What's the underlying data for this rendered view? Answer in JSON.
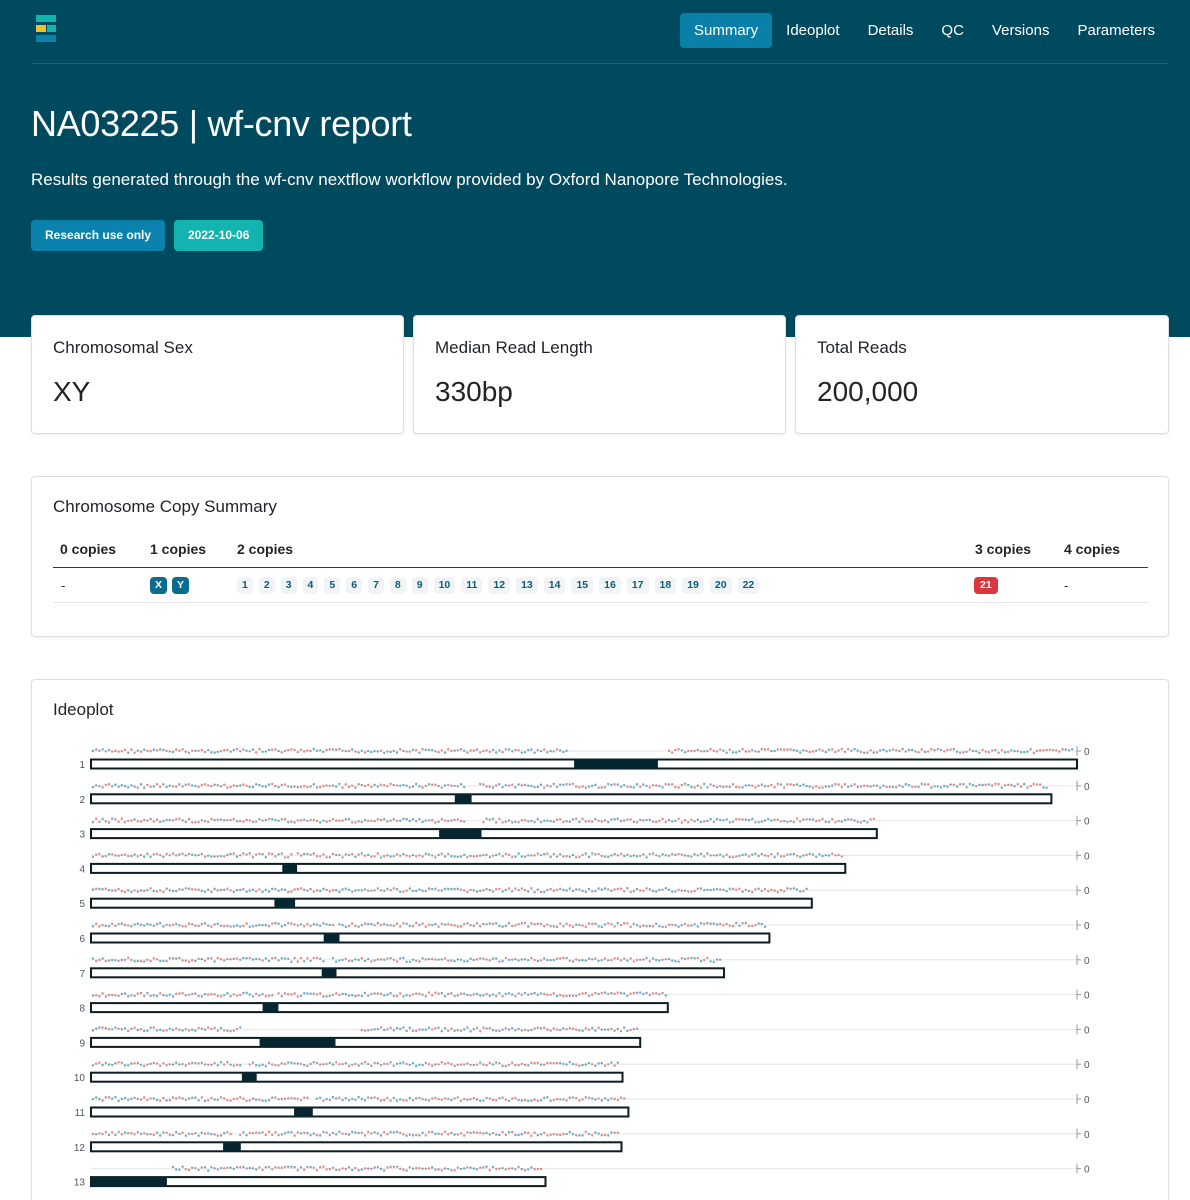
{
  "brand": {
    "logo_icon": "epi2me-logo-icon",
    "colors": {
      "teal": "#13b3b0",
      "yellow": "#f2c12e",
      "blue": "#0b82ad"
    }
  },
  "nav": {
    "items": [
      {
        "label": "Summary",
        "active": true
      },
      {
        "label": "Ideoplot",
        "active": false
      },
      {
        "label": "Details",
        "active": false
      },
      {
        "label": "QC",
        "active": false
      },
      {
        "label": "Versions",
        "active": false
      },
      {
        "label": "Parameters",
        "active": false
      }
    ]
  },
  "header": {
    "title": "NA03225 | wf-cnv report",
    "subtitle": "Results generated through the wf-cnv nextflow workflow provided by Oxford Nanopore Technologies.",
    "badges": {
      "ruo": "Research use only",
      "date": "2022-10-06"
    }
  },
  "stats": [
    {
      "label": "Chromosomal Sex",
      "value": "XY"
    },
    {
      "label": "Median Read Length",
      "value": "330bp"
    },
    {
      "label": "Total Reads",
      "value": "200,000"
    }
  ],
  "copy_summary": {
    "title": "Chromosome Copy Summary",
    "columns": [
      "0 copies",
      "1 copies",
      "2 copies",
      "3 copies",
      "4 copies"
    ],
    "zero_copies": "-",
    "one_copies": [
      "X",
      "Y"
    ],
    "two_copies": [
      "1",
      "2",
      "3",
      "4",
      "5",
      "6",
      "7",
      "8",
      "9",
      "10",
      "11",
      "12",
      "13",
      "14",
      "15",
      "16",
      "17",
      "18",
      "19",
      "20",
      "22"
    ],
    "three_copies": [
      "21"
    ],
    "four_copies": "-"
  },
  "ideoplot": {
    "title": "Ideoplot",
    "axis_tick": "0",
    "chromosomes": [
      {
        "label": "1",
        "length": 1.0,
        "centromere": [
          0.49,
          0.575
        ],
        "gap": [
          0.483,
          0.585
        ]
      },
      {
        "label": "2",
        "length": 0.974,
        "centromere": [
          0.369,
          0.386
        ],
        "gap": [
          0.38,
          0.392
        ]
      },
      {
        "label": "3",
        "length": 0.797,
        "centromere": [
          0.353,
          0.396
        ],
        "gap": [
          0.381,
          0.397
        ]
      },
      {
        "label": "4",
        "length": 0.765,
        "centromere": [
          0.194,
          0.209
        ],
        "gap": [
          0.205,
          0.208
        ]
      },
      {
        "label": "5",
        "length": 0.731,
        "centromere": [
          0.186,
          0.207
        ],
        "gap": null
      },
      {
        "label": "6",
        "length": 0.688,
        "centromere": [
          0.236,
          0.252
        ],
        "gap": [
          0.246,
          0.249
        ]
      },
      {
        "label": "7",
        "length": 0.642,
        "centromere": [
          0.234,
          0.249
        ],
        "gap": [
          0.237,
          0.244
        ]
      },
      {
        "label": "8",
        "length": 0.585,
        "centromere": [
          0.174,
          0.19
        ],
        "gap": [
          0.186,
          0.188
        ]
      },
      {
        "label": "9",
        "length": 0.557,
        "centromere": [
          0.171,
          0.248
        ],
        "gap": [
          0.152,
          0.274
        ]
      },
      {
        "label": "10",
        "length": 0.539,
        "centromere": [
          0.153,
          0.168
        ],
        "gap": [
          0.153,
          0.16
        ]
      },
      {
        "label": "11",
        "length": 0.545,
        "centromere": [
          0.206,
          0.225
        ],
        "gap": [
          0.221,
          0.226
        ]
      },
      {
        "label": "12",
        "length": 0.538,
        "centromere": [
          0.134,
          0.152
        ],
        "gap": [
          0.142,
          0.149
        ]
      },
      {
        "label": "13",
        "length": 0.461,
        "centromere": [
          0.0,
          0.077
        ],
        "gap": [
          0.0,
          0.079
        ]
      }
    ]
  }
}
